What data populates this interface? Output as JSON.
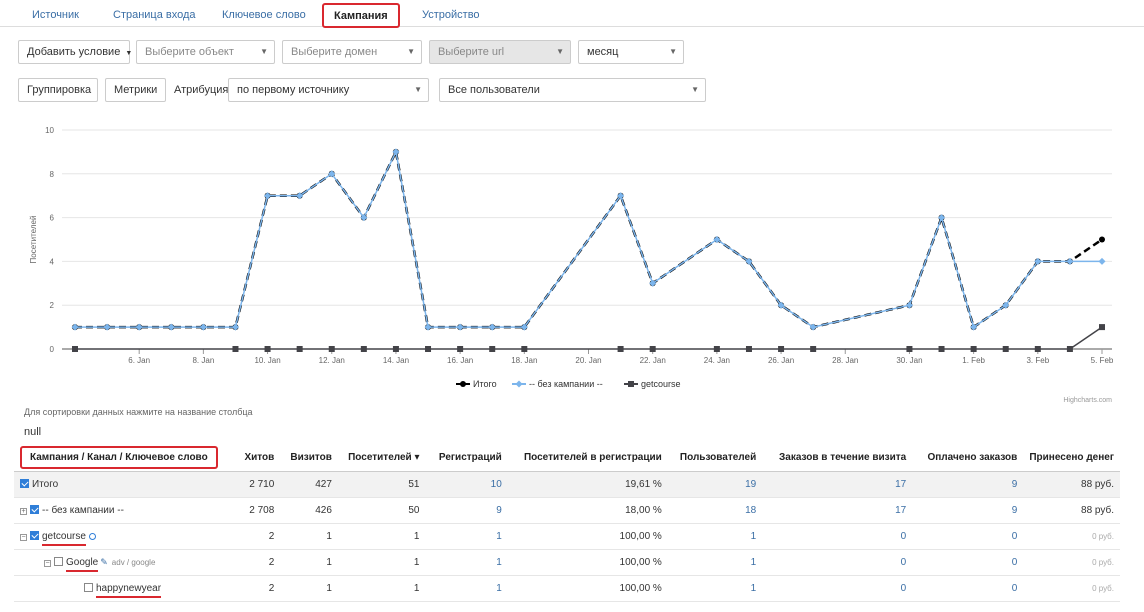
{
  "tabs": [
    "Источник",
    "Страница входа",
    "Ключевое слово",
    "Кампания",
    "Устройство"
  ],
  "filters": {
    "add_condition": "Добавить условие",
    "object_placeholder": "Выберите объект",
    "domain_placeholder": "Выберите домен",
    "url_placeholder": "Выберите url",
    "period": "месяц",
    "grouping": "Группировка",
    "metrics": "Метрики",
    "attribution_label": "Атрибуция",
    "attribution_value": "по первому источнику",
    "users_value": "Все пользователи"
  },
  "chart_data": {
    "type": "line",
    "ylabel": "Посетителей",
    "ylim": [
      0,
      10
    ],
    "yticks": [
      0,
      2,
      4,
      6,
      8,
      10
    ],
    "x": [
      "4. Jan",
      "5. Jan",
      "6. Jan",
      "7. Jan",
      "8. Jan",
      "9. Jan",
      "10. Jan",
      "11. Jan",
      "12. Jan",
      "13. Jan",
      "14. Jan",
      "15. Jan",
      "16. Jan",
      "17. Jan",
      "18. Jan",
      "19. Jan",
      "20. Jan",
      "21. Jan",
      "22. Jan",
      "23. Jan",
      "24. Jan",
      "25. Jan",
      "26. Jan",
      "27. Jan",
      "28. Jan",
      "29. Jan",
      "30. Jan",
      "31. Jan",
      "1. Feb",
      "2. Feb",
      "3. Feb",
      "4. Feb",
      "5. Feb"
    ],
    "xticks": [
      "6. Jan",
      "8. Jan",
      "10. Jan",
      "12. Jan",
      "14. Jan",
      "16. Jan",
      "18. Jan",
      "20. Jan",
      "22. Jan",
      "24. Jan",
      "26. Jan",
      "28. Jan",
      "30. Jan",
      "1. Feb",
      "3. Feb",
      "5. Feb"
    ],
    "series": [
      {
        "name": "Итого",
        "color": "#000000",
        "values": [
          1,
          1,
          1,
          1,
          1,
          1,
          7,
          7,
          8,
          6,
          9,
          1,
          1,
          1,
          1,
          null,
          null,
          7,
          3,
          null,
          5,
          4,
          2,
          1,
          null,
          null,
          2,
          6,
          1,
          2,
          4,
          4,
          5
        ]
      },
      {
        "name": "-- без кампании --",
        "color": "#7cb5ec",
        "values": [
          1,
          1,
          1,
          1,
          1,
          1,
          7,
          7,
          8,
          6,
          9,
          1,
          1,
          1,
          1,
          null,
          null,
          7,
          3,
          null,
          5,
          4,
          2,
          1,
          null,
          null,
          2,
          6,
          1,
          2,
          4,
          4,
          4
        ]
      },
      {
        "name": "getcourse",
        "color": "#434348",
        "values": [
          0,
          null,
          null,
          null,
          null,
          0,
          0,
          0,
          0,
          0,
          0,
          0,
          0,
          0,
          0,
          null,
          null,
          0,
          0,
          null,
          0,
          0,
          0,
          0,
          null,
          null,
          0,
          0,
          0,
          0,
          0,
          0,
          1
        ]
      }
    ],
    "credit": "Highcharts.com"
  },
  "table": {
    "hint": "Для сортировки данных нажмите на название столбца",
    "null_text": "null",
    "headers": [
      "Кампания / Канал / Ключевое слово",
      "Хитов",
      "Визитов",
      "Посетителей ▾",
      "Регистраций",
      "Посетителей в регистрации",
      "Пользователей",
      "Заказов в течение визита",
      "Оплачено заказов",
      "Принесено денег"
    ],
    "rows": [
      {
        "name": "Итого",
        "cells": [
          "2 710",
          "427",
          "51",
          "10",
          "19,61 %",
          "19",
          "17",
          "9",
          "88 руб."
        ]
      },
      {
        "name": "-- без кампании --",
        "cells": [
          "2 708",
          "426",
          "50",
          "9",
          "18,00 %",
          "18",
          "17",
          "9",
          "88 руб."
        ]
      },
      {
        "name": "getcourse",
        "cells": [
          "2",
          "1",
          "1",
          "1",
          "100,00 %",
          "1",
          "0",
          "0",
          "0 руб."
        ]
      },
      {
        "name": "Google",
        "sub": "adv / google",
        "cells": [
          "2",
          "1",
          "1",
          "1",
          "100,00 %",
          "1",
          "0",
          "0",
          "0 руб."
        ]
      },
      {
        "name": "happynewyear",
        "cells": [
          "2",
          "1",
          "1",
          "1",
          "100,00 %",
          "1",
          "0",
          "0",
          "0 руб."
        ]
      }
    ]
  }
}
